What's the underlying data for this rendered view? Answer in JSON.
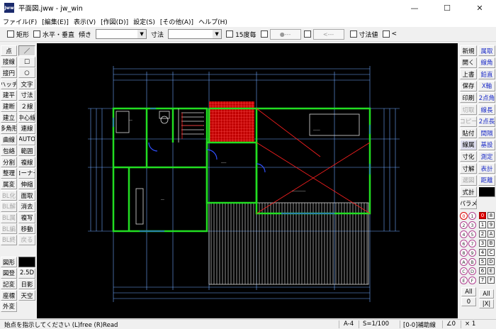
{
  "window": {
    "title": "平面図.jww - jw_win",
    "icon_text": "Jww",
    "controls": {
      "minimize": "—",
      "maximize": "☐",
      "close": "✕"
    }
  },
  "menu": [
    "ファイル(F)",
    "[編集(E)]",
    "表示(V)",
    "[作図(D)]",
    "設定(S)",
    "[その他(A)]",
    "ヘルプ(H)"
  ],
  "toolbar": {
    "rect": "矩形",
    "horiz_vert": "水平・垂直",
    "tilt": "傾き",
    "dim": "寸法",
    "deg15": "15度毎",
    "btn_circle": "●---",
    "btn_arrow": "<---",
    "dim_value": "寸法値",
    "lt": "<"
  },
  "left_tools": {
    "col1": [
      "点",
      "接線",
      "接円",
      "ハッチ",
      "建平",
      "建断",
      "建立",
      "多角形",
      "曲線",
      "包絡",
      "分割",
      "整理",
      "属変",
      "BL化",
      "BL解",
      "BL属",
      "BL編",
      "BL終"
    ],
    "col2": [
      "／",
      "□",
      "○",
      "文字",
      "寸法",
      "２線",
      "中心線",
      "連線",
      "AUTO",
      "範囲",
      "複線",
      "コーナー",
      "伸縮",
      "面取",
      "消去",
      "複写",
      "移動",
      "戻る"
    ],
    "col1b": [
      "図形",
      "図登",
      "記変",
      "座標",
      "外変"
    ],
    "col2b": [
      "",
      "2.5D",
      "日影",
      "天空"
    ],
    "disabled": [
      "BL化",
      "BL解",
      "BL属",
      "BL編",
      "BL終",
      "戻る"
    ]
  },
  "right_tools": {
    "col1": [
      "新規",
      "開く",
      "上書",
      "保存",
      "印刷",
      "切取",
      "コピー",
      "貼付",
      "線属",
      "寸化",
      "寸解",
      "選図",
      "式計",
      "パラメ"
    ],
    "col2": [
      "属取",
      "線角",
      "鉛直",
      "X軸",
      "2点角",
      "線長",
      "2点長",
      "間隔",
      "基設",
      "測定",
      "表計",
      "距離"
    ],
    "disabled": [
      "切取",
      "コピー",
      "選図"
    ]
  },
  "layer_groups": [
    "0",
    "1",
    "2",
    "3",
    "4",
    "5",
    "6",
    "7",
    "8",
    "9",
    "A",
    "B",
    "C",
    "D",
    "E",
    "F"
  ],
  "layers": [
    "0",
    "8",
    "1",
    "9",
    "2",
    "A",
    "3",
    "B",
    "4",
    "C",
    "5",
    "D",
    "6",
    "E",
    "7",
    "F"
  ],
  "layer_bottom": {
    "all_label": "All",
    "group_value": "0",
    "all2": "All",
    "arrow": "|X|"
  },
  "status": {
    "message": "始点を指示してください (L)free (R)Read",
    "paper": "A-4",
    "scale": "S=1/100",
    "layer": "[0-0]補助線",
    "angle": "∠0",
    "zoom": "× 1"
  },
  "colors": {
    "canvas_bg": "#000000",
    "wall": "#22dd22",
    "dim": "#8fbfff",
    "accent_red": "#ff2020",
    "window": "#3050ff"
  }
}
